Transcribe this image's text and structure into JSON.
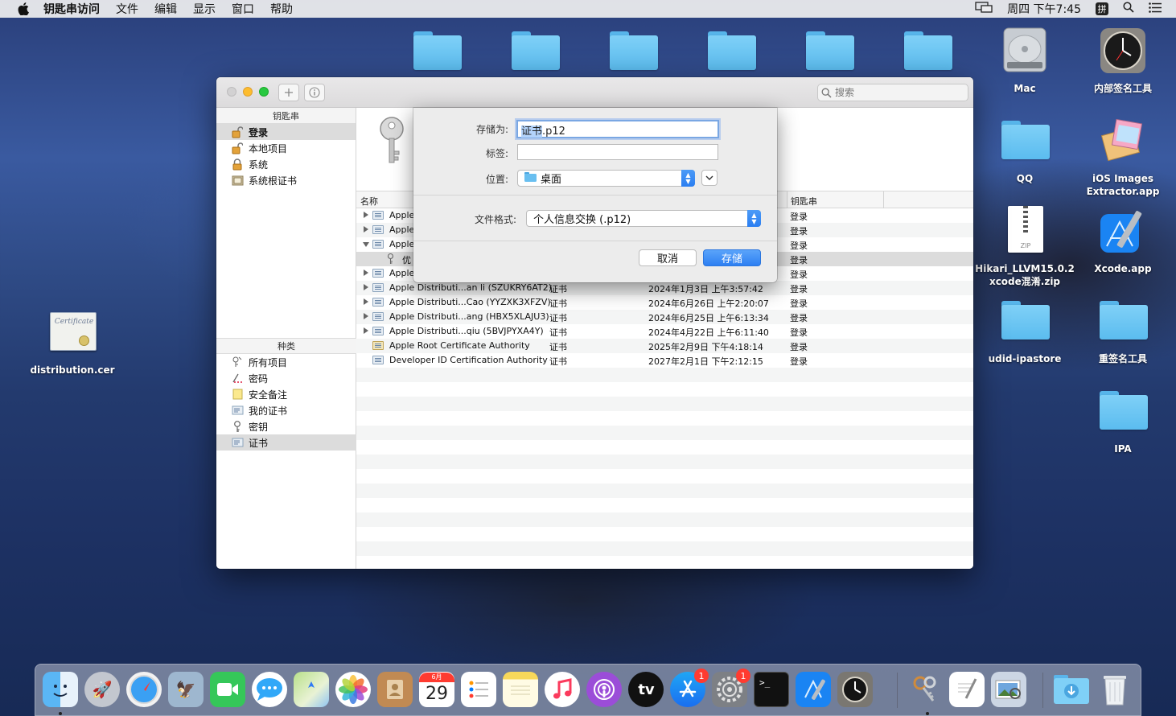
{
  "menubar": {
    "app_name": "钥匙串访问",
    "items": [
      "文件",
      "编辑",
      "显示",
      "窗口",
      "帮助"
    ],
    "clock": "周四 下午7:45",
    "ime": "拼"
  },
  "desktop": {
    "items": [
      {
        "label": "Mac"
      },
      {
        "label": "内部签名工具"
      },
      {
        "label": "QQ"
      },
      {
        "label": "iOS Images Extractor.app"
      },
      {
        "label": "Hikari_LLVM15.0.2 xcode混淆.zip"
      },
      {
        "label": "Xcode.app"
      },
      {
        "label": "udid-ipastore"
      },
      {
        "label": "重签名工具"
      },
      {
        "label": "IPA"
      },
      {
        "label": "distribution.cer"
      }
    ],
    "zip_tag": "ZIP",
    "cert_script": "Certificate"
  },
  "window": {
    "search_placeholder": "搜索",
    "sidebar": {
      "keychains_header": "钥匙串",
      "keychains": [
        "登录",
        "本地项目",
        "系统",
        "系统根证书"
      ],
      "category_header": "种类",
      "categories": [
        "所有项目",
        "密码",
        "安全备注",
        "我的证书",
        "密钥",
        "证书"
      ]
    },
    "columns": {
      "name": "名称",
      "keychain": "钥匙串"
    },
    "rows": [
      {
        "name": "Apple",
        "kind": "",
        "date": "",
        "keychain": "登录"
      },
      {
        "name": "Apple",
        "kind": "",
        "date": "",
        "keychain": "登录"
      },
      {
        "name": "Apple",
        "kind": "",
        "date": "",
        "keychain": "登录"
      },
      {
        "name": "优",
        "kind": "",
        "date": "",
        "keychain": "登录"
      },
      {
        "name": "Apple",
        "kind": "",
        "date": "",
        "keychain": "登录"
      },
      {
        "name": "Apple Distributi...an li (SZUKRY6AT2)",
        "kind": "证书",
        "date": "2024年1月3日 上午3:57:42",
        "keychain": "登录"
      },
      {
        "name": "Apple Distributi...Cao (YYZXK3XFZV)",
        "kind": "证书",
        "date": "2024年6月26日 上午2:20:07",
        "keychain": "登录"
      },
      {
        "name": "Apple Distributi...ang (HBX5XLAJU3)",
        "kind": "证书",
        "date": "2024年6月25日 上午6:13:34",
        "keychain": "登录"
      },
      {
        "name": "Apple Distributi...qiu (5BVJPYXA4Y)",
        "kind": "证书",
        "date": "2024年4月22日 上午6:11:40",
        "keychain": "登录"
      },
      {
        "name": "Apple Root Certificate Authority",
        "kind": "证书",
        "date": "2025年2月9日 下午4:18:14",
        "keychain": "登录"
      },
      {
        "name": "Developer ID Certification Authority",
        "kind": "证书",
        "date": "2027年2月1日 下午2:12:15",
        "keychain": "登录"
      }
    ]
  },
  "sheet": {
    "save_as_label": "存储为:",
    "save_as_selected": "证书",
    "save_as_rest": ".p12",
    "tags_label": "标签:",
    "location_label": "位置:",
    "location_value": "桌面",
    "format_label": "文件格式:",
    "format_value": "个人信息交换 (.p12)",
    "cancel": "取消",
    "save": "存储"
  },
  "dock": {
    "calendar_month": "6月",
    "calendar_day": "29",
    "appstore_badge": "1",
    "settings_badge": "1",
    "tv_label": "tv"
  },
  "colors": {
    "accent": "#2d7ff2",
    "folder": "#6cc6f3",
    "badge": "#ff3b30"
  }
}
